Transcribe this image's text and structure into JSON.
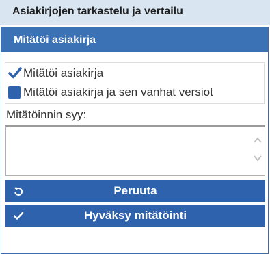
{
  "window": {
    "title": "Asiakirjojen tarkastelu ja vertailu"
  },
  "dialog": {
    "title": "Mitätöi asiakirja",
    "options": [
      {
        "label": "Mitätöi asiakirja",
        "checked": true
      },
      {
        "label": "Mitätöi asiakirja ja sen vanhat versiot",
        "checked": false
      }
    ],
    "reason": {
      "label": "Mitätöinnin syy:",
      "value": ""
    },
    "buttons": {
      "cancel_label": "Peruuta",
      "cancel_icon": "undo-icon",
      "approve_label": "Hyväksy mitätöinti",
      "approve_icon": "check-icon"
    }
  },
  "colors": {
    "accent": "#2f62ad",
    "header": "#3a72b5",
    "title_bar": "#d9e5f1"
  }
}
